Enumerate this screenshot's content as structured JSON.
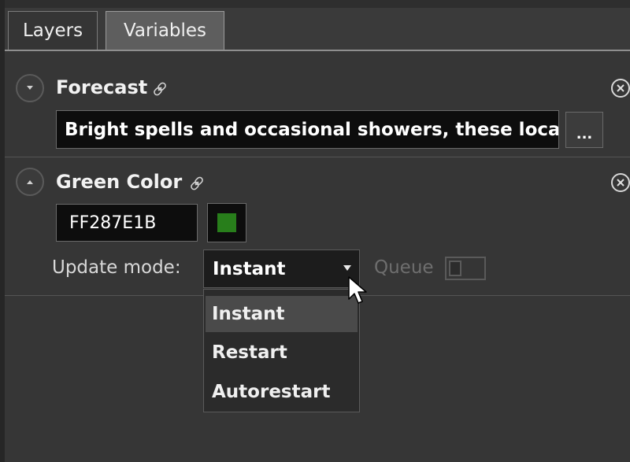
{
  "tabs": [
    {
      "label": "Layers",
      "active": false
    },
    {
      "label": "Variables",
      "active": true
    }
  ],
  "variables": [
    {
      "name": "Forecast",
      "expanded": false,
      "value": "Bright spells and occasional showers, these locall",
      "edit_button_label": "..."
    },
    {
      "name": "Green Color",
      "expanded": true,
      "value": "FF287E1B",
      "swatch_color": "#287E1B",
      "update_mode": {
        "label": "Update mode:",
        "selected": "Instant",
        "options": [
          "Instant",
          "Restart",
          "Autorestart"
        ],
        "highlighted": "Instant"
      },
      "queue": {
        "label": "Queue",
        "enabled": false
      }
    }
  ],
  "icons": {
    "expand": "chevron-down-icon",
    "collapse": "chevron-up-icon",
    "link": "link-icon",
    "remove": "remove-circle-icon"
  }
}
